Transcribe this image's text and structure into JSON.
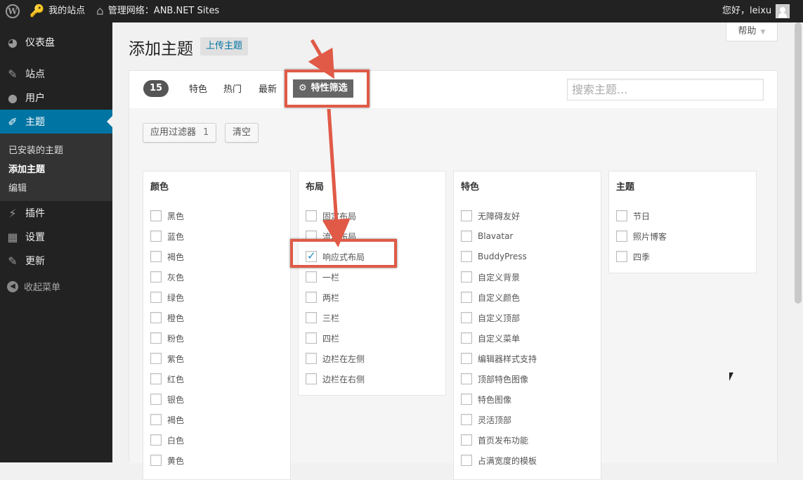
{
  "adminbar": {
    "my_sites": "我的站点",
    "network_admin": "管理网络：ANB.NET Sites",
    "greeting": "您好，leixu"
  },
  "sidebar": {
    "items": [
      {
        "label": "仪表盘",
        "icon": "dashboard-icon"
      },
      {
        "label": "站点",
        "icon": "tools-icon"
      },
      {
        "label": "用户",
        "icon": "users-icon"
      },
      {
        "label": "主题",
        "icon": "brush-icon"
      }
    ],
    "submenu": [
      "已安装的主题",
      "添加主题",
      "编辑"
    ],
    "items2": [
      {
        "label": "插件",
        "icon": "plugin-icon"
      },
      {
        "label": "设置",
        "icon": "settings-icon"
      },
      {
        "label": "更新",
        "icon": "wrench-icon"
      }
    ],
    "collapse": "收起菜单"
  },
  "help": "帮助",
  "page": {
    "title": "添加主题",
    "upload_button": "上传主题"
  },
  "filter_bar": {
    "count": "15",
    "tabs": [
      "特色",
      "热门",
      "最新"
    ],
    "feature_filter": "特性筛选",
    "search_placeholder": "搜索主题..."
  },
  "actions": {
    "apply_filters": "应用过滤器",
    "apply_count": "1",
    "clear": "清空"
  },
  "groups": {
    "color": {
      "title": "颜色",
      "options": [
        "黑色",
        "蓝色",
        "褐色",
        "灰色",
        "绿色",
        "橙色",
        "粉色",
        "紫色",
        "红色",
        "银色",
        "褐色",
        "白色",
        "黄色"
      ]
    },
    "layout": {
      "title": "布局",
      "options": [
        "固定布局",
        "流水布局",
        "响应式布局",
        "一栏",
        "两栏",
        "三栏",
        "四栏",
        "边栏在左侧",
        "边栏在右侧"
      ],
      "checked_index": 2
    },
    "features": {
      "title": "特色",
      "options": [
        "无障碍友好",
        "Blavatar",
        "BuddyPress",
        "自定义背景",
        "自定义颜色",
        "自定义顶部",
        "自定义菜单",
        "编辑器样式支持",
        "顶部特色图像",
        "特色图像",
        "灵活顶部",
        "首页发布功能",
        "占满宽度的模板"
      ]
    },
    "subject": {
      "title": "主题",
      "options": [
        "节日",
        "照片博客",
        "四季"
      ]
    }
  },
  "colors": {
    "accent": "#0074a2",
    "annotation": "#e05a47",
    "sidebar_bg": "#222222"
  }
}
